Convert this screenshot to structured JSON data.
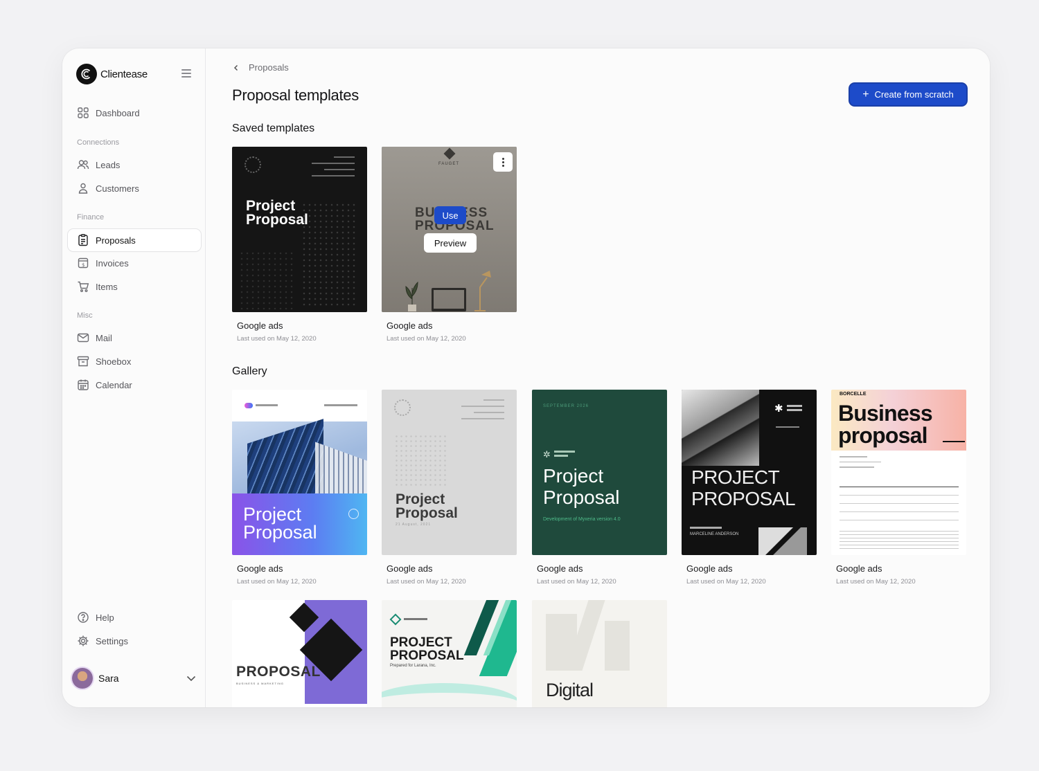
{
  "app": {
    "name": "Clientease"
  },
  "sidebar": {
    "dashboard": "Dashboard",
    "sections": {
      "connections": "Connections",
      "finance": "Finance",
      "misc": "Misc"
    },
    "items": {
      "leads": "Leads",
      "customers": "Customers",
      "proposals": "Proposals",
      "invoices": "Invoices",
      "items": "Items",
      "mail": "Mail",
      "shoebox": "Shoebox",
      "calendar": "Calendar",
      "help": "Help",
      "settings": "Settings"
    },
    "user": {
      "name": "Sara"
    }
  },
  "header": {
    "breadcrumb": "Proposals",
    "title": "Proposal templates",
    "create_button": "Create from scratch"
  },
  "saved": {
    "title": "Saved templates",
    "cards": [
      {
        "name": "Google ads",
        "meta": "Last used on May 12, 2020",
        "thumb_title": "Project Proposal"
      },
      {
        "name": "Google ads",
        "meta": "Last used on May 12, 2020",
        "thumb_title": "BUSINESS PROPOSAL",
        "thumb_brand": "FAUGET",
        "use_label": "Use",
        "preview_label": "Preview"
      }
    ]
  },
  "gallery": {
    "title": "Gallery",
    "cards": [
      {
        "name": "Google ads",
        "meta": "Last used on May 12, 2020",
        "thumb_title": "Project Proposal"
      },
      {
        "name": "Google ads",
        "meta": "Last used on May 12, 2020",
        "thumb_title": "Project Proposal",
        "thumb_date": "21 August, 2021"
      },
      {
        "name": "Google ads",
        "meta": "Last used on May 12, 2020",
        "thumb_title": "Project Proposal",
        "thumb_kicker": "SEPTEMBER 2026",
        "thumb_sub": "Development of Myxeria version 4.0"
      },
      {
        "name": "Google ads",
        "meta": "Last used on May 12, 2020",
        "thumb_title": "PROJECT PROPOSAL",
        "thumb_sub": "MARCELINE ANDERSON"
      },
      {
        "name": "Google ads",
        "meta": "Last used on May 12, 2020",
        "thumb_title": "Business proposal",
        "thumb_brand": "BORCELLE"
      }
    ],
    "row2": [
      {
        "thumb_title": "PROPOSAL",
        "thumb_sub": "BUSINESS & MARKETING"
      },
      {
        "thumb_title": "PROJECT PROPOSAL",
        "thumb_sub": "Prepared for Larana, Inc."
      },
      {
        "thumb_title": "Digital"
      }
    ]
  },
  "colors": {
    "accent": "#1d4bc9",
    "green_template": "#1f4a3c",
    "purple_template": "#7e6ad6"
  }
}
